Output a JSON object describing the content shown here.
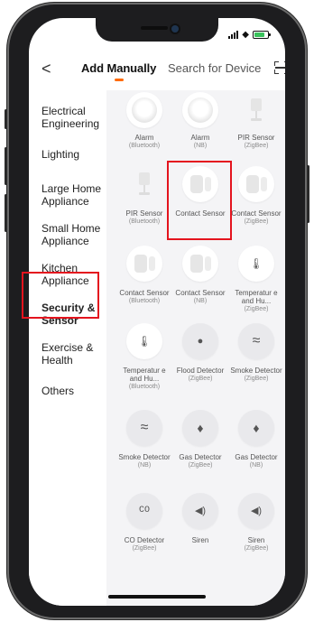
{
  "nav": {
    "back_glyph": "<",
    "tab_manual": "Add Manually",
    "tab_search": "Search for Device",
    "accent": "#ff6a00"
  },
  "sidebar": {
    "items": [
      {
        "label": "Electrical Engineering"
      },
      {
        "label": "Lighting"
      },
      {
        "label": "Large Home Appliance"
      },
      {
        "label": "Small Home Appliance"
      },
      {
        "label": "Kitchen Appliance"
      },
      {
        "label": "Security & Sensor"
      },
      {
        "label": "Exercise & Health"
      },
      {
        "label": "Others"
      }
    ]
  },
  "devices": [
    {
      "name": "",
      "sub": "",
      "icon": "alarm-disc-icon"
    },
    {
      "name": "",
      "sub": "",
      "icon": "alarm-disc-icon"
    },
    {
      "name": "",
      "sub": "",
      "icon": "pir-sensor-icon"
    },
    {
      "name": "Alarm",
      "sub": "(Bluetooth)",
      "icon": "alarm-icon"
    },
    {
      "name": "Alarm",
      "sub": "(NB)",
      "icon": "alarm-icon"
    },
    {
      "name": "PIR Sensor",
      "sub": "(ZigBee)",
      "icon": "pir-sensor-icon"
    },
    {
      "name": "PIR Sensor",
      "sub": "(Bluetooth)",
      "icon": "pir-sensor-icon"
    },
    {
      "name": "Contact Sensor",
      "sub": "",
      "icon": "contact-sensor-icon"
    },
    {
      "name": "Contact Sensor",
      "sub": "(ZigBee)",
      "icon": "contact-sensor-icon"
    },
    {
      "name": "Contact Sensor",
      "sub": "(Bluetooth)",
      "icon": "contact-sensor-icon"
    },
    {
      "name": "Contact Sensor",
      "sub": "(NB)",
      "icon": "contact-sensor-icon"
    },
    {
      "name": "Temperatur e and Hu...",
      "sub": "(ZigBee)",
      "icon": "thermometer-icon"
    },
    {
      "name": "Temperatur e and Hu...",
      "sub": "(Bluetooth)",
      "icon": "thermometer-icon"
    },
    {
      "name": "Flood Detector",
      "sub": "(ZigBee)",
      "icon": "water-drop-icon"
    },
    {
      "name": "Smoke Detector",
      "sub": "(ZigBee)",
      "icon": "smoke-icon"
    },
    {
      "name": "Smoke Detector",
      "sub": "(NB)",
      "icon": "smoke-icon"
    },
    {
      "name": "Gas Detector",
      "sub": "(ZigBee)",
      "icon": "flame-icon"
    },
    {
      "name": "Gas Detector",
      "sub": "(NB)",
      "icon": "flame-icon"
    },
    {
      "name": "CO Detector",
      "sub": "(ZigBee)",
      "icon": "co-icon",
      "glyph": "CO"
    },
    {
      "name": "Siren",
      "sub": "",
      "icon": "speaker-icon"
    },
    {
      "name": "Siren",
      "sub": "(ZigBee)",
      "icon": "speaker-icon"
    }
  ],
  "colors": {
    "highlight": "#e4141e",
    "content_bg": "#f4f4f6"
  }
}
